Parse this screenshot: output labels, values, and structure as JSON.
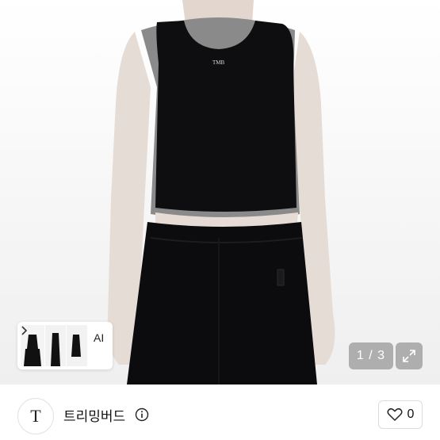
{
  "gallery": {
    "thumbnail_label": "AI",
    "page_counter": "1 / 3",
    "current_page": 1,
    "total_pages": 3,
    "garment_logo_text": "TMB"
  },
  "shop": {
    "name": "트리밍버드",
    "logo_text": "T",
    "like_count": "0"
  },
  "icons": {
    "expand": "expand-icon",
    "info": "info-icon",
    "heart": "heart-outline-icon",
    "chevron": "chevron-right-icon"
  },
  "colors": {
    "garment": "#0e0e10",
    "trim": "#8a8a8a",
    "overlay": "#787878"
  }
}
